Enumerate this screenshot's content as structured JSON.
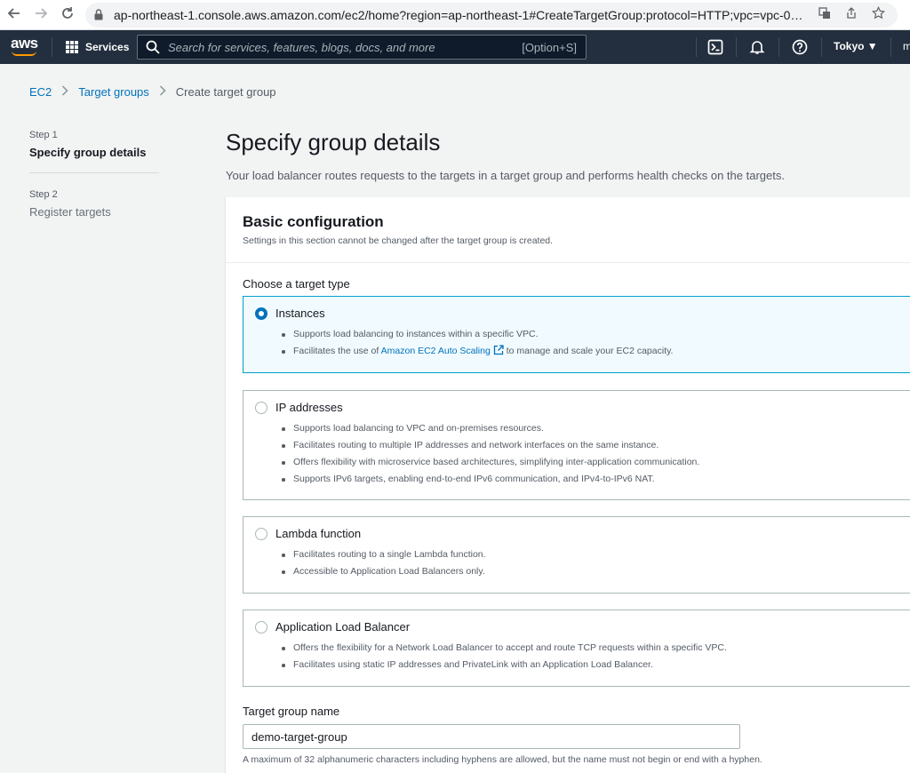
{
  "browser": {
    "back_icon": "arrow-left-icon",
    "forward_icon": "arrow-right-icon",
    "reload_icon": "reload-icon",
    "url": "ap-northeast-1.console.aws.amazon.com/ec2/home?region=ap-northeast-1#CreateTargetGroup:protocol=HTTP;vpc=vpc-05..."
  },
  "aws_nav": {
    "logo_text": "aws",
    "services_label": "Services",
    "search_placeholder": "Search for services, features, blogs, docs, and more",
    "search_shortcut": "[Option+S]",
    "region": "Tokyo ▼",
    "account_initial": "m"
  },
  "breadcrumb": {
    "items": [
      "EC2",
      "Target groups",
      "Create target group"
    ]
  },
  "steps": [
    {
      "number": "Step 1",
      "title": "Specify group details",
      "active": true
    },
    {
      "number": "Step 2",
      "title": "Register targets",
      "active": false
    }
  ],
  "header": {
    "title": "Specify group details",
    "description": "Your load balancer routes requests to the targets in a target group and performs health checks on the targets."
  },
  "basic_config": {
    "title": "Basic configuration",
    "description": "Settings in this section cannot be changed after the target group is created.",
    "target_type_label": "Choose a target type",
    "options": [
      {
        "title": "Instances",
        "selected": true,
        "bullets": [
          "Supports load balancing to instances within a specific VPC.",
          "Facilitates the use of",
          "Amazon EC2 Auto Scaling",
          "to manage and scale your EC2 capacity."
        ]
      },
      {
        "title": "IP addresses",
        "selected": false,
        "bullets": [
          "Supports load balancing to VPC and on-premises resources.",
          "Facilitates routing to multiple IP addresses and network interfaces on the same instance.",
          "Offers flexibility with microservice based architectures, simplifying inter-application communication.",
          "Supports IPv6 targets, enabling end-to-end IPv6 communication, and IPv4-to-IPv6 NAT."
        ]
      },
      {
        "title": "Lambda function",
        "selected": false,
        "bullets": [
          "Facilitates routing to a single Lambda function.",
          "Accessible to Application Load Balancers only."
        ]
      },
      {
        "title": "Application Load Balancer",
        "selected": false,
        "bullets": [
          "Offers the flexibility for a Network Load Balancer to accept and route TCP requests within a specific VPC.",
          "Facilitates using static IP addresses and PrivateLink with an Application Load Balancer."
        ]
      }
    ],
    "name_label": "Target group name",
    "name_value": "demo-target-group",
    "name_constraint": "A maximum of 32 alphanumeric characters including hyphens are allowed, but the name must not begin or end with a hyphen."
  },
  "colors": {
    "aws_nav_bg": "#232f3e",
    "link": "#0073bb",
    "selected_border": "#00a1c9",
    "aws_orange": "#ff9900"
  }
}
